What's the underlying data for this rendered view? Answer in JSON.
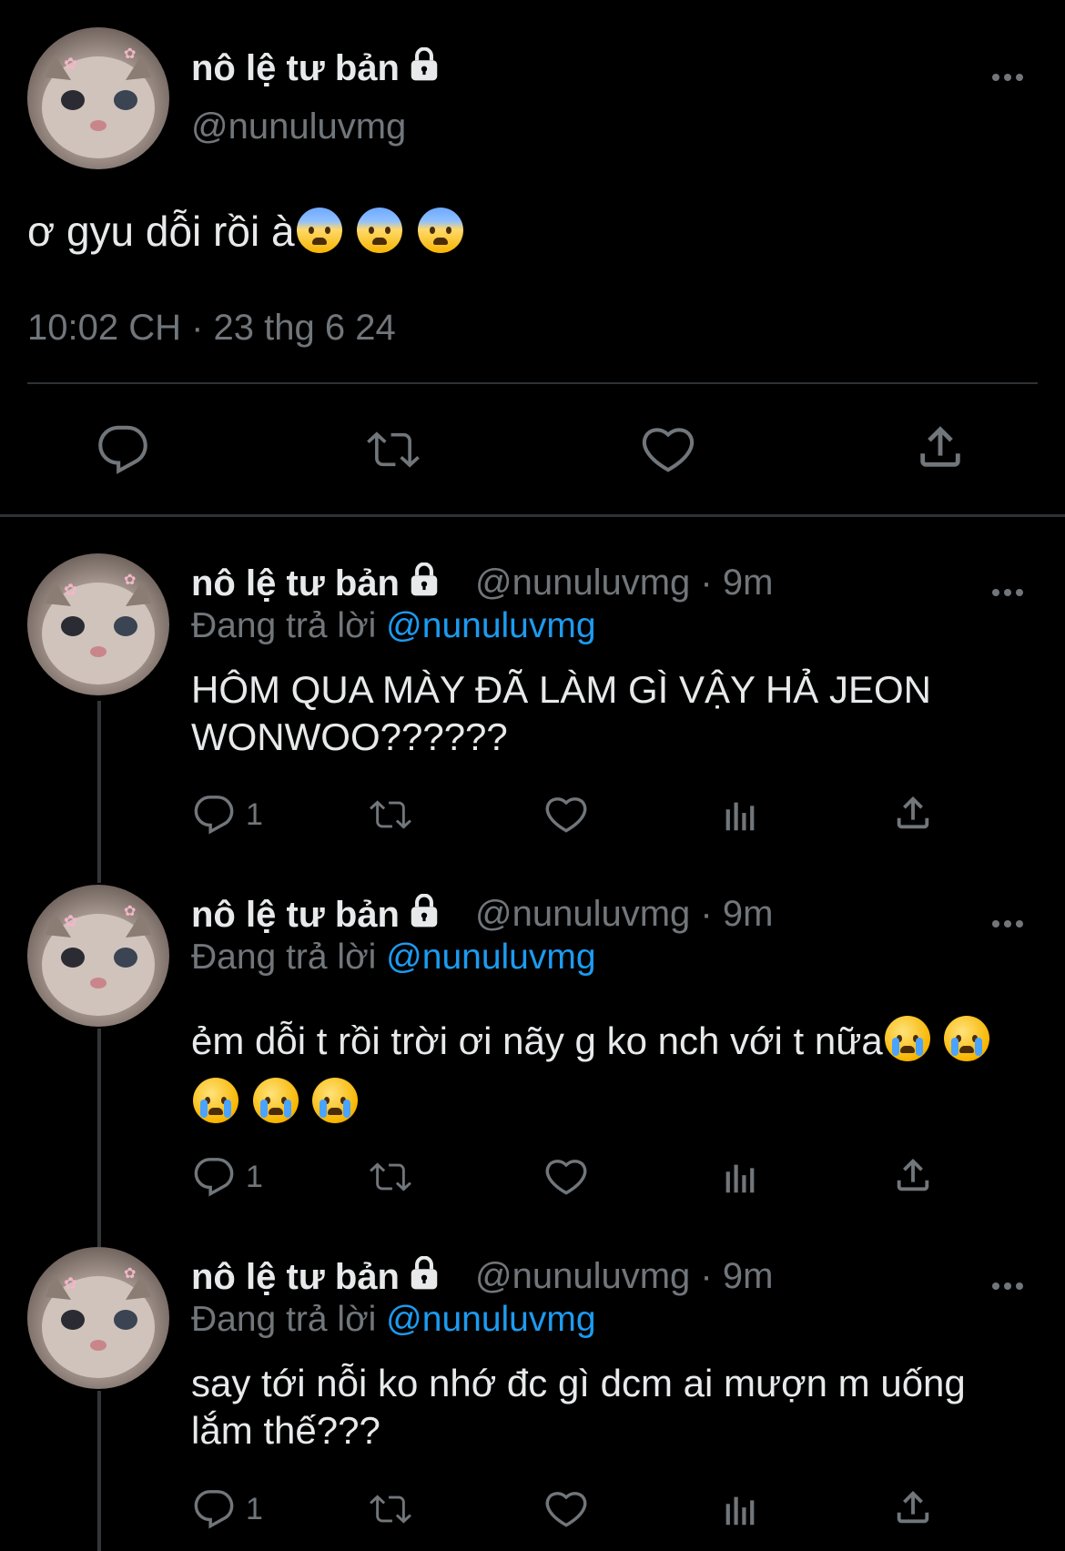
{
  "main_tweet": {
    "display_name": "nô lệ tư bản",
    "handle": "@nunuluvmg",
    "text": "ơ gyu dỗi rồi à",
    "timestamp": "10:02 CH · 23 thg 6 24",
    "emoji": "anxious-face-with-sweat ×3"
  },
  "replies": [
    {
      "display_name": "nô lệ tư bản",
      "handle_time": "@nunuluvmg · 9m",
      "replying_prefix": "Đang trả lời ",
      "replying_to": "@nunuluvmg",
      "text": "HÔM QUA MÀY ĐÃ LÀM GÌ VẬY HẢ JEON WONWOO??????",
      "reply_count": "1"
    },
    {
      "display_name": "nô lệ tư bản",
      "handle_time": "@nunuluvmg · 9m",
      "replying_prefix": "Đang trả lời ",
      "replying_to": "@nunuluvmg",
      "text": "ẻm dỗi t rồi trời ơi nãy g ko nch với t nữa",
      "reply_count": "1"
    },
    {
      "display_name": "nô lệ tư bản",
      "handle_time": "@nunuluvmg · 9m",
      "replying_prefix": "Đang trả lời ",
      "replying_to": "@nunuluvmg",
      "text": "say tới nỗi ko nhớ đc gì dcm ai mượn m uống lắm thế???",
      "reply_count": "1"
    }
  ],
  "icons": [
    "lock-icon",
    "more-icon",
    "reply-icon",
    "retweet-icon",
    "like-icon",
    "views-icon",
    "share-icon"
  ],
  "colors": {
    "background": "#000000",
    "text": "#e7e9ea",
    "muted": "#71767b",
    "link": "#1d9bf0"
  }
}
